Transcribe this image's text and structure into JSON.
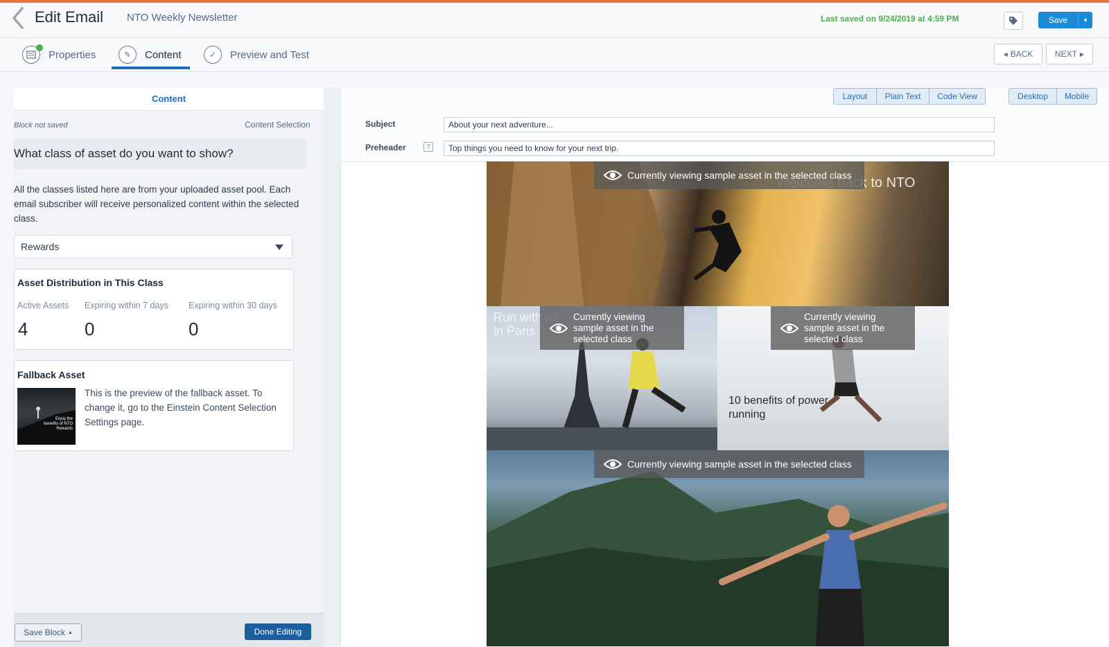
{
  "header": {
    "title": "Edit Email",
    "subtitle": "NTO Weekly Newsletter",
    "last_saved": "Last saved on 9/24/2019 at 4:59 PM",
    "save_label": "Save"
  },
  "steps": [
    {
      "label": "Properties",
      "icon": "properties-check-icon"
    },
    {
      "label": "Content",
      "icon": "pencil-icon",
      "active": true
    },
    {
      "label": "Preview and Test",
      "icon": "checkmark-icon"
    }
  ],
  "nav": {
    "back_label": "BACK",
    "next_label": "NEXT"
  },
  "panel": {
    "tab_label": "Content",
    "block_status": "Block not saved",
    "content_selection": "Content Selection",
    "question": "What class of asset do you want to show?",
    "description": "All the classes listed here are from your uploaded asset pool. Each email subscriber will receive personalized content within the selected class.",
    "selected_class": "Rewards",
    "distribution": {
      "title": "Asset Distribution in This Class",
      "stats": [
        {
          "label": "Active Assets",
          "value": "4"
        },
        {
          "label": "Expiring within 7 days",
          "value": "0"
        },
        {
          "label": "Expiring within 30 days",
          "value": "0"
        }
      ]
    },
    "fallback": {
      "title": "Fallback Asset",
      "thumb_caption": "Enjoy the benefits of NTO Rewards",
      "text": "This is the preview of the fallback asset. To change it, go to the Einstein Content Selection Settings page."
    },
    "save_block_label": "Save Block",
    "done_label": "Done Editing"
  },
  "view_buttons": {
    "layout": "Layout",
    "plain_text": "Plain Text",
    "code_view": "Code View",
    "desktop": "Desktop",
    "mobile": "Mobile"
  },
  "fields": {
    "subject_label": "Subject",
    "subject_value": "About your next adventure...",
    "preheader_label": "Preheader",
    "preheader_value": "Top things you need to know for your next trip."
  },
  "email": {
    "overlay_text": "Currently viewing sample asset in the selected class",
    "hero_caption": "Welcome back to NTO",
    "paris_caption": "Run with us in Paris",
    "power_caption": "10 benefits of power running"
  },
  "colors": {
    "accent": "#e8743b",
    "primary": "#1b8ad6",
    "saved_green": "#4bae4f"
  }
}
